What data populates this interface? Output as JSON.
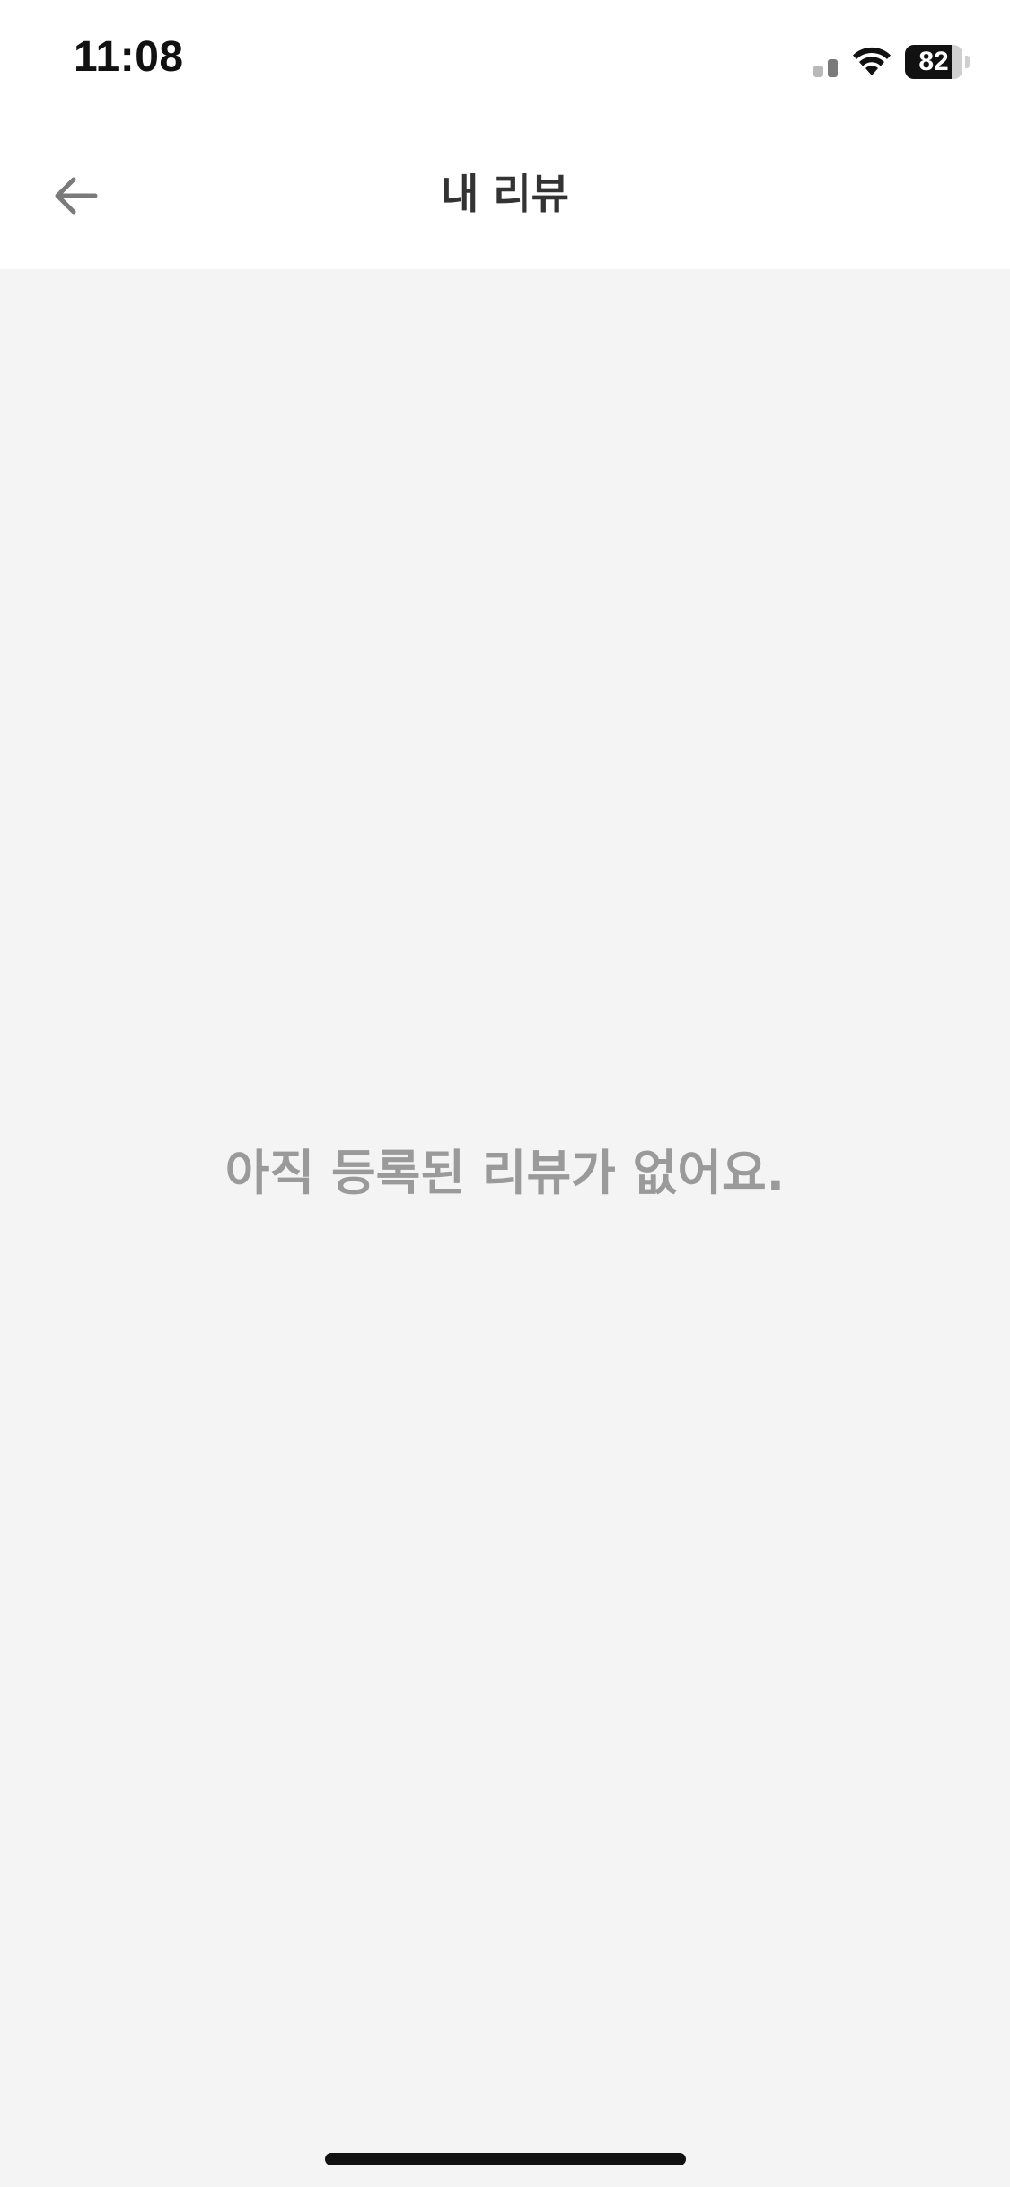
{
  "status_bar": {
    "time": "11:08",
    "battery_level": 82,
    "battery_label": "82",
    "icons": [
      "signal-icon",
      "wifi-icon",
      "battery-icon"
    ]
  },
  "nav": {
    "title": "내 리뷰",
    "back_icon": "back-arrow-icon"
  },
  "content": {
    "empty_message": "아직 등록된 리뷰가 없어요."
  },
  "colors": {
    "background": "#f4f4f4",
    "header_background": "#ffffff",
    "title_text": "#333333",
    "empty_text": "#9a9a9a",
    "icon_gray": "#7a7a7a"
  }
}
